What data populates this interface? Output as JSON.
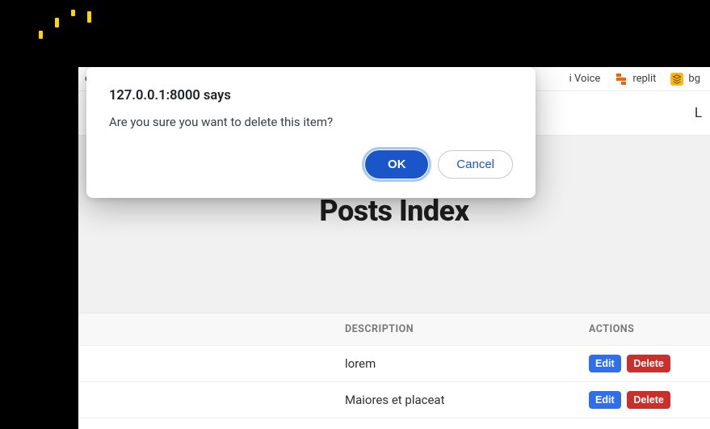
{
  "decor": {
    "yellow_bars": true
  },
  "bookmarks": {
    "left_fragment": "e",
    "right": [
      {
        "id": "ai-voice",
        "label": "i Voice",
        "icon": "ai-voice-icon"
      },
      {
        "id": "replit",
        "label": "replit",
        "icon": "replit-icon"
      },
      {
        "id": "bg",
        "label": "bg",
        "icon": "bg-icon"
      }
    ]
  },
  "nav": {
    "right_fragment": "L"
  },
  "hero": {
    "title": "Posts Index"
  },
  "table": {
    "headers": {
      "description": "DESCRIPTION",
      "actions": "ACTIONS"
    },
    "rows": [
      {
        "description": "lorem"
      },
      {
        "description": "Maiores et placeat"
      }
    ],
    "buttons": {
      "edit": "Edit",
      "delete": "Delete"
    }
  },
  "dialog": {
    "title": "127.0.0.1:8000 says",
    "message": "Are you sure you want to delete this item?",
    "ok": "OK",
    "cancel": "Cancel"
  }
}
